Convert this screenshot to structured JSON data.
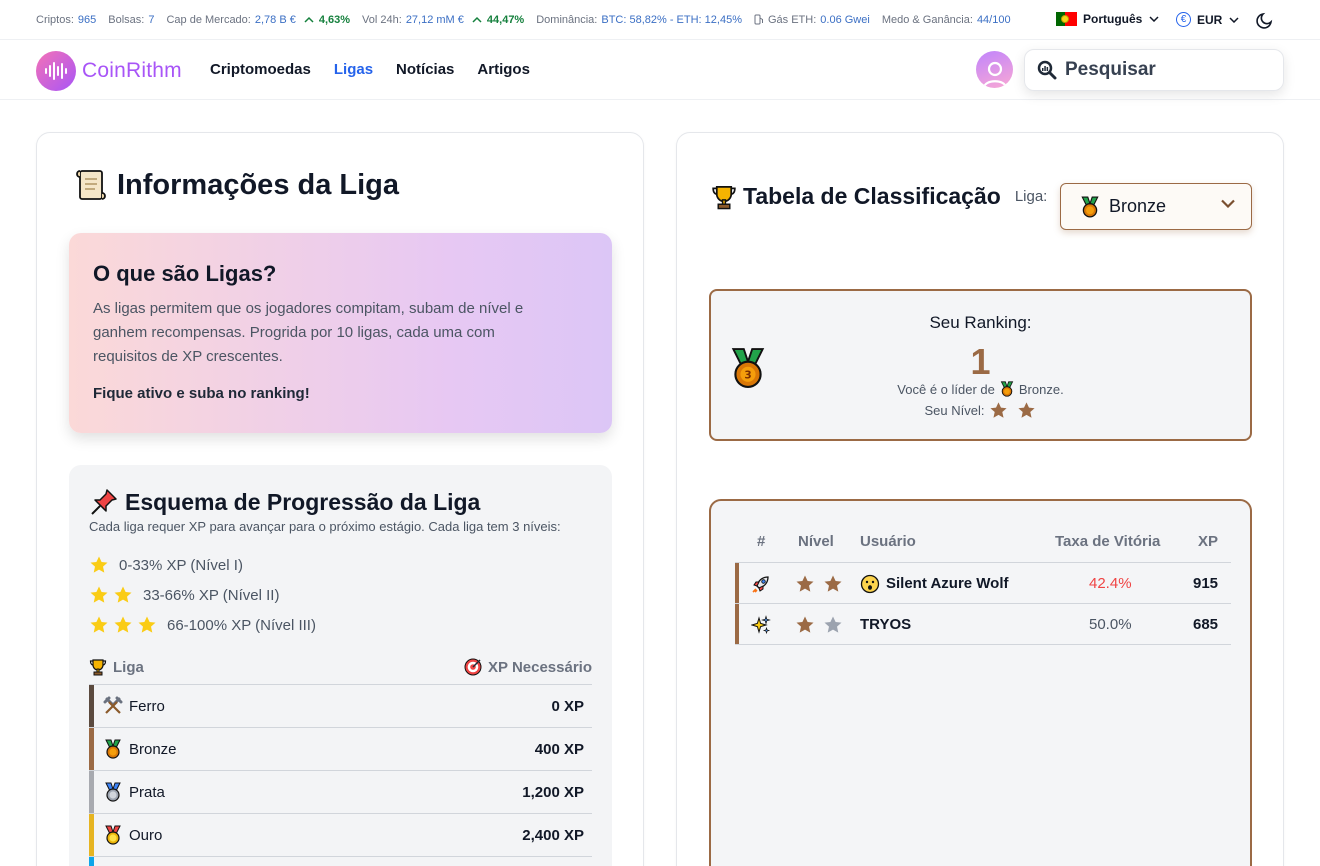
{
  "ticker": {
    "cryptos_label": "Criptos:",
    "cryptos_value": "965",
    "exchanges_label": "Bolsas:",
    "exchanges_value": "7",
    "mcap_label": "Cap de Mercado:",
    "mcap_value": "2,78 B €",
    "mcap_change": "4,63%",
    "vol_label": "Vol 24h:",
    "vol_value": "27,12 mM €",
    "vol_change": "44,47%",
    "dom_label": "Dominância:",
    "dom_value": "BTC: 58,82% - ETH: 12,45%",
    "gas_label": "Gás ETH:",
    "gas_value": "0.06 Gwei",
    "fear_label": "Medo & Ganância:",
    "fear_value": "44/100",
    "language": "Português",
    "currency": "EUR"
  },
  "nav": {
    "logo_text": "CoinRithm",
    "links": [
      "Criptomoedas",
      "Ligas",
      "Notícias",
      "Artigos"
    ],
    "active_link": "Ligas",
    "search_placeholder": "Pesquisar"
  },
  "info": {
    "title": "Informações da Liga",
    "what_title": "O que são Ligas?",
    "what_text": "As ligas permitem que os jogadores compitam, subam de nível e ganhem recompensas. Progrida por 10 ligas, cada uma com requisitos de XP crescentes.",
    "what_cta": "Fique ativo e suba no ranking!",
    "scheme_title": "Esquema de Progressão da Liga",
    "scheme_sub": "Cada liga requer XP para avançar para o próximo estágio. Cada liga tem 3 níveis:",
    "levels": [
      "0-33% XP (Nível I)",
      "33-66% XP (Nível II)",
      "66-100% XP (Nível III)"
    ],
    "col_league": "Liga",
    "col_xp": "XP Necessário",
    "leagues": [
      {
        "name": "Ferro",
        "xp": "0 XP",
        "color": "#5b4a3f"
      },
      {
        "name": "Bronze",
        "xp": "400 XP",
        "color": "#9b6a45"
      },
      {
        "name": "Prata",
        "xp": "1,200 XP",
        "color": "#a8aab0"
      },
      {
        "name": "Ouro",
        "xp": "2,400 XP",
        "color": "#e6b422"
      }
    ]
  },
  "ranking": {
    "title": "Tabela de Classificação",
    "league_label": "Liga:",
    "selected_league": "Bronze",
    "your_ranking_label": "Seu Ranking:",
    "your_rank": "1",
    "leader_prefix": "Você é o líder de",
    "leader_league": "Bronze.",
    "your_level_label": "Seu Nível:",
    "columns": [
      "#",
      "Nível",
      "Usuário",
      "Taxa de Vitória",
      "XP"
    ],
    "rows": [
      {
        "icon": "rocket-icon",
        "stars_filled": 2,
        "user": "Silent Azure Wolf",
        "win_rate": "42.4%",
        "win_color": "#ef4444",
        "xp": "915"
      },
      {
        "icon": "sparkles-icon",
        "stars_filled": 1,
        "user": "TRYOS",
        "win_rate": "50.0%",
        "win_color": "#4b5563",
        "xp": "685"
      }
    ]
  },
  "colors": {
    "accent": "#2563eb",
    "bronze": "#9b6a45",
    "brand": "#a855f7",
    "positive": "#15803d"
  }
}
